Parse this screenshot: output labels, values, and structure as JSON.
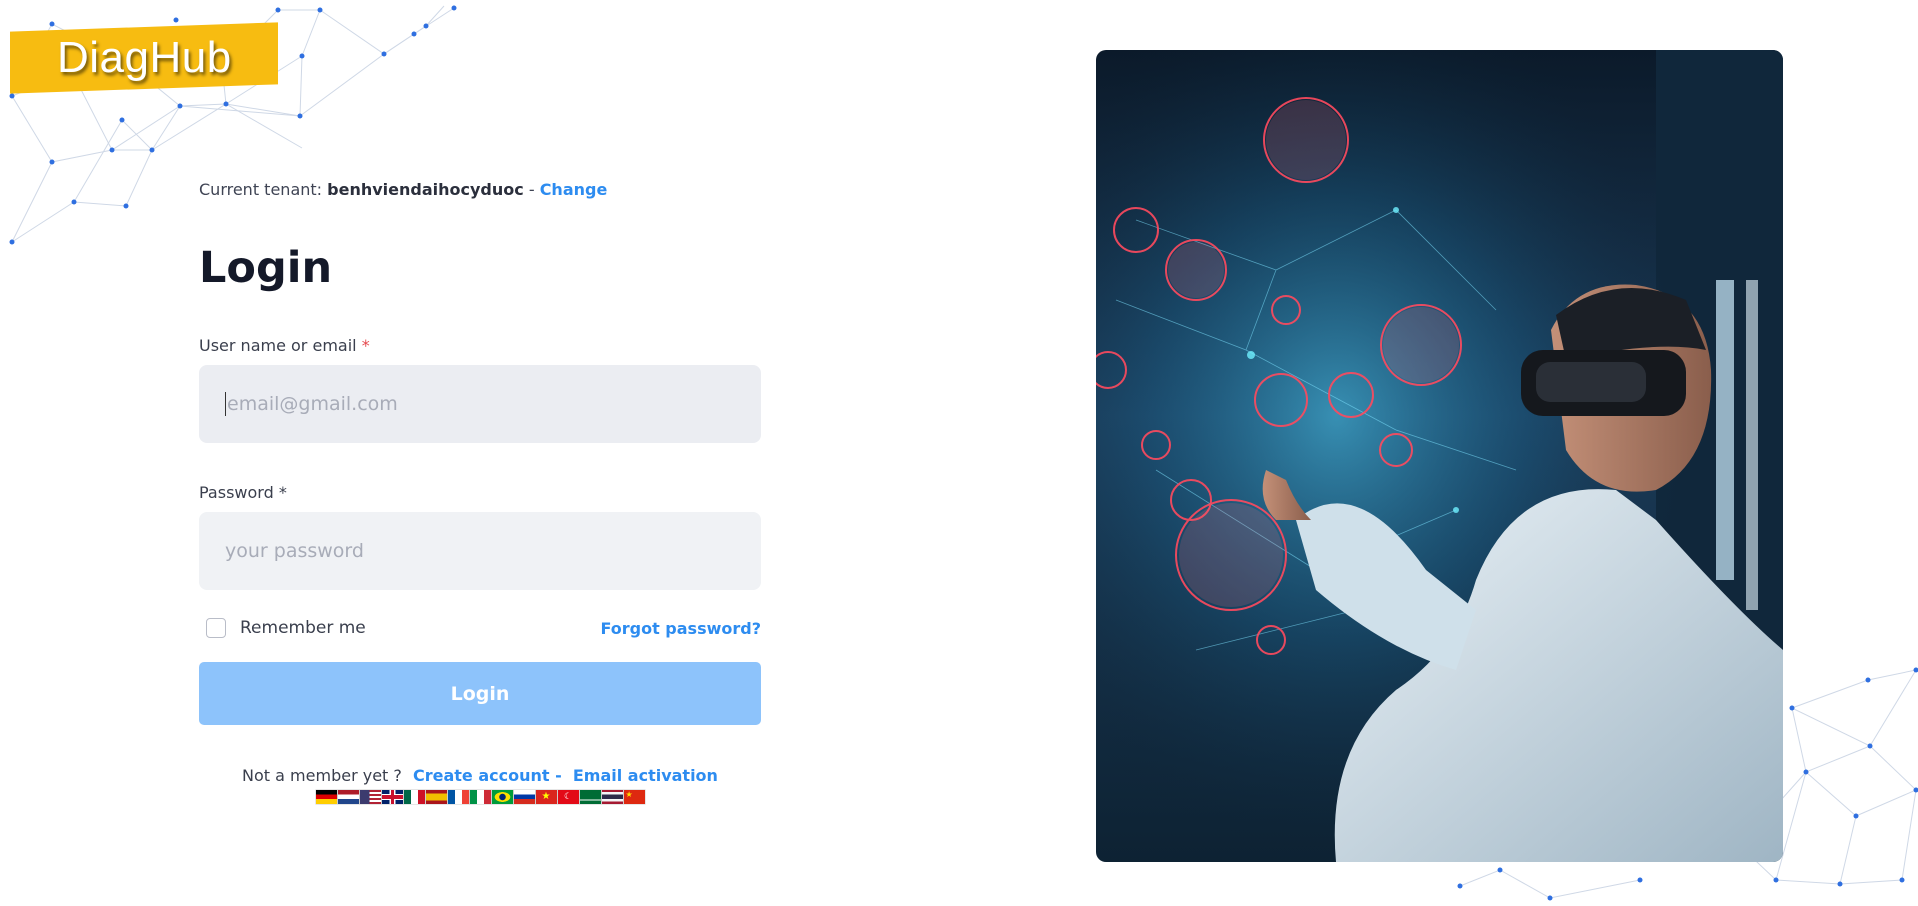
{
  "brand": {
    "name": "DiagHub"
  },
  "tenant": {
    "prefix": "Current tenant: ",
    "name": "benhviendaihocyduoc",
    "separator": " - ",
    "change_link": "Change"
  },
  "login": {
    "title": "Login",
    "username": {
      "label": "User name or email",
      "required_mark": "*",
      "placeholder": "email@gmail.com",
      "value": ""
    },
    "password": {
      "label": "Password",
      "required_mark": "*",
      "placeholder": "your password",
      "value": ""
    },
    "remember_me": {
      "label": "Remember me",
      "checked": false
    },
    "forgot_link": "Forgot password?",
    "submit_label": "Login"
  },
  "signup": {
    "prompt": "Not a member yet ?",
    "create_account": "Create account -",
    "email_activation": "Email activation"
  },
  "languages": [
    "german-flag-icon",
    "dutch-flag-icon",
    "us-flag-icon",
    "uk-flag-icon",
    "mexico-flag-icon",
    "spain-flag-icon",
    "france-flag-icon",
    "italy-flag-icon",
    "brazil-flag-icon",
    "russia-flag-icon",
    "vietnam-flag-icon",
    "turkey-flag-icon",
    "saudi-arabia-flag-icon",
    "thailand-flag-icon",
    "china-flag-icon"
  ],
  "colors": {
    "brand": "#f7bc11",
    "link": "#2d8cf0",
    "button": "#8dc3fb",
    "required": "#e5484d"
  }
}
